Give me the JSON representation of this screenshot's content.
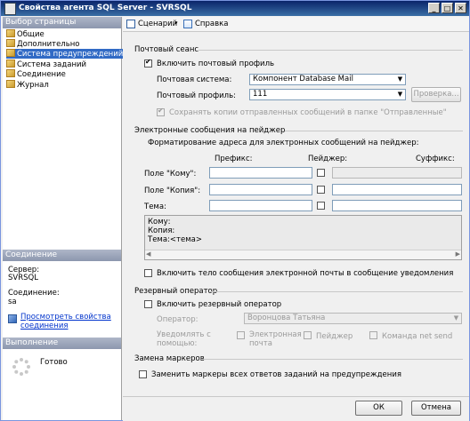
{
  "window": {
    "title": "Свойства агента SQL Server - SVRSQL"
  },
  "titlebar": {
    "minimize": "_",
    "maximize": "□",
    "close": "✕"
  },
  "left": {
    "select_page_header": "Выбор страницы",
    "nav": [
      "Общие",
      "Дополнительно",
      "Система предупреждений",
      "Система заданий",
      "Соединение",
      "Журнал"
    ],
    "connection_header": "Соединение",
    "server_label": "Сервер:",
    "server_value": "SVRSQL",
    "conn_label": "Соединение:",
    "conn_value": "sa",
    "view_props_link": "Просмотреть свойства соединения",
    "progress_header": "Выполнение",
    "progress_status": "Готово"
  },
  "toolbar": {
    "script": "Сценарий",
    "help": "Справка"
  },
  "mail": {
    "group": "Почтовый сеанс",
    "enable_label": "Включить почтовый профиль",
    "system_label": "Почтовая система:",
    "system_value": "Компонент Database Mail",
    "profile_label": "Почтовый профиль:",
    "profile_value": "111",
    "test_button": "Проверка...",
    "save_copies_label": "Сохранять копии отправленных сообщений в папке \"Отправленные\""
  },
  "pager": {
    "group": "Электронные сообщения на пейджер",
    "format_label": "Форматирование адреса для электронных сообщений на пейджер:",
    "col_prefix": "Префикс:",
    "col_pager": "Пейджер:",
    "col_suffix": "Суффикс:",
    "to_label": "Поле \"Кому\":",
    "cc_label": "Поле \"Копия\":",
    "subject_label": "Тема:",
    "preview": [
      "Кому:",
      "Копия:",
      "Тема:<тема>"
    ],
    "include_body_label": "Включить тело сообщения электронной почты в сообщение уведомления"
  },
  "failsafe": {
    "group": "Резервный оператор",
    "enable_label": "Включить резервный оператор",
    "operator_label": "Оператор:",
    "operator_value": "Воронцова Татьяна",
    "notify_label": "Уведомлять с помощью:",
    "opt_email": "Электронная почта",
    "opt_pager": "Пейджер",
    "opt_netsend": "Команда net send"
  },
  "tokens": {
    "group": "Замена маркеров",
    "replace_label": "Заменить маркеры всех ответов заданий на предупреждения"
  },
  "buttons": {
    "ok": "ОК",
    "cancel": "Отмена"
  }
}
